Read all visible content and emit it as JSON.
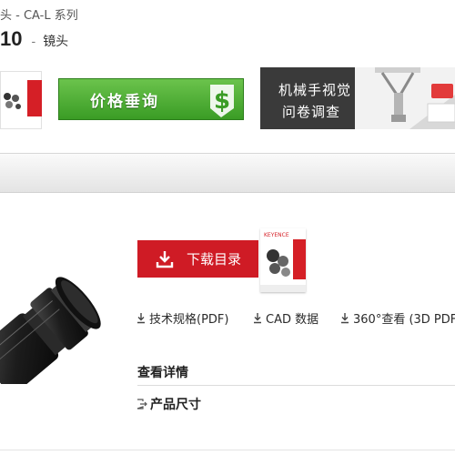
{
  "header": {
    "breadcrumb": "头 - CA-L 系列",
    "title_model": "10",
    "title_separator": "-",
    "title_desc": "镜头"
  },
  "banners": {
    "price_inquiry": "价格垂询",
    "survey_line1": "机械手视觉",
    "survey_line2": "问卷调查",
    "catalog_brand": "KEYENCE"
  },
  "product": {
    "download_label": "下载目录",
    "links": {
      "spec": "技术规格(PDF)",
      "cad": "CAD 数据",
      "view360": "360°查看 (3D PDF"
    },
    "details_heading": "查看详情",
    "dimensions_link": "产品尺寸"
  },
  "colors": {
    "accent_red": "#cf1b25",
    "green": "#4caf30",
    "survey_bg": "#3a3a3a"
  },
  "icons": [
    "download-icon",
    "dollar-icon",
    "robot-arm-icon",
    "catalog-icon",
    "arrow-link-icon"
  ]
}
